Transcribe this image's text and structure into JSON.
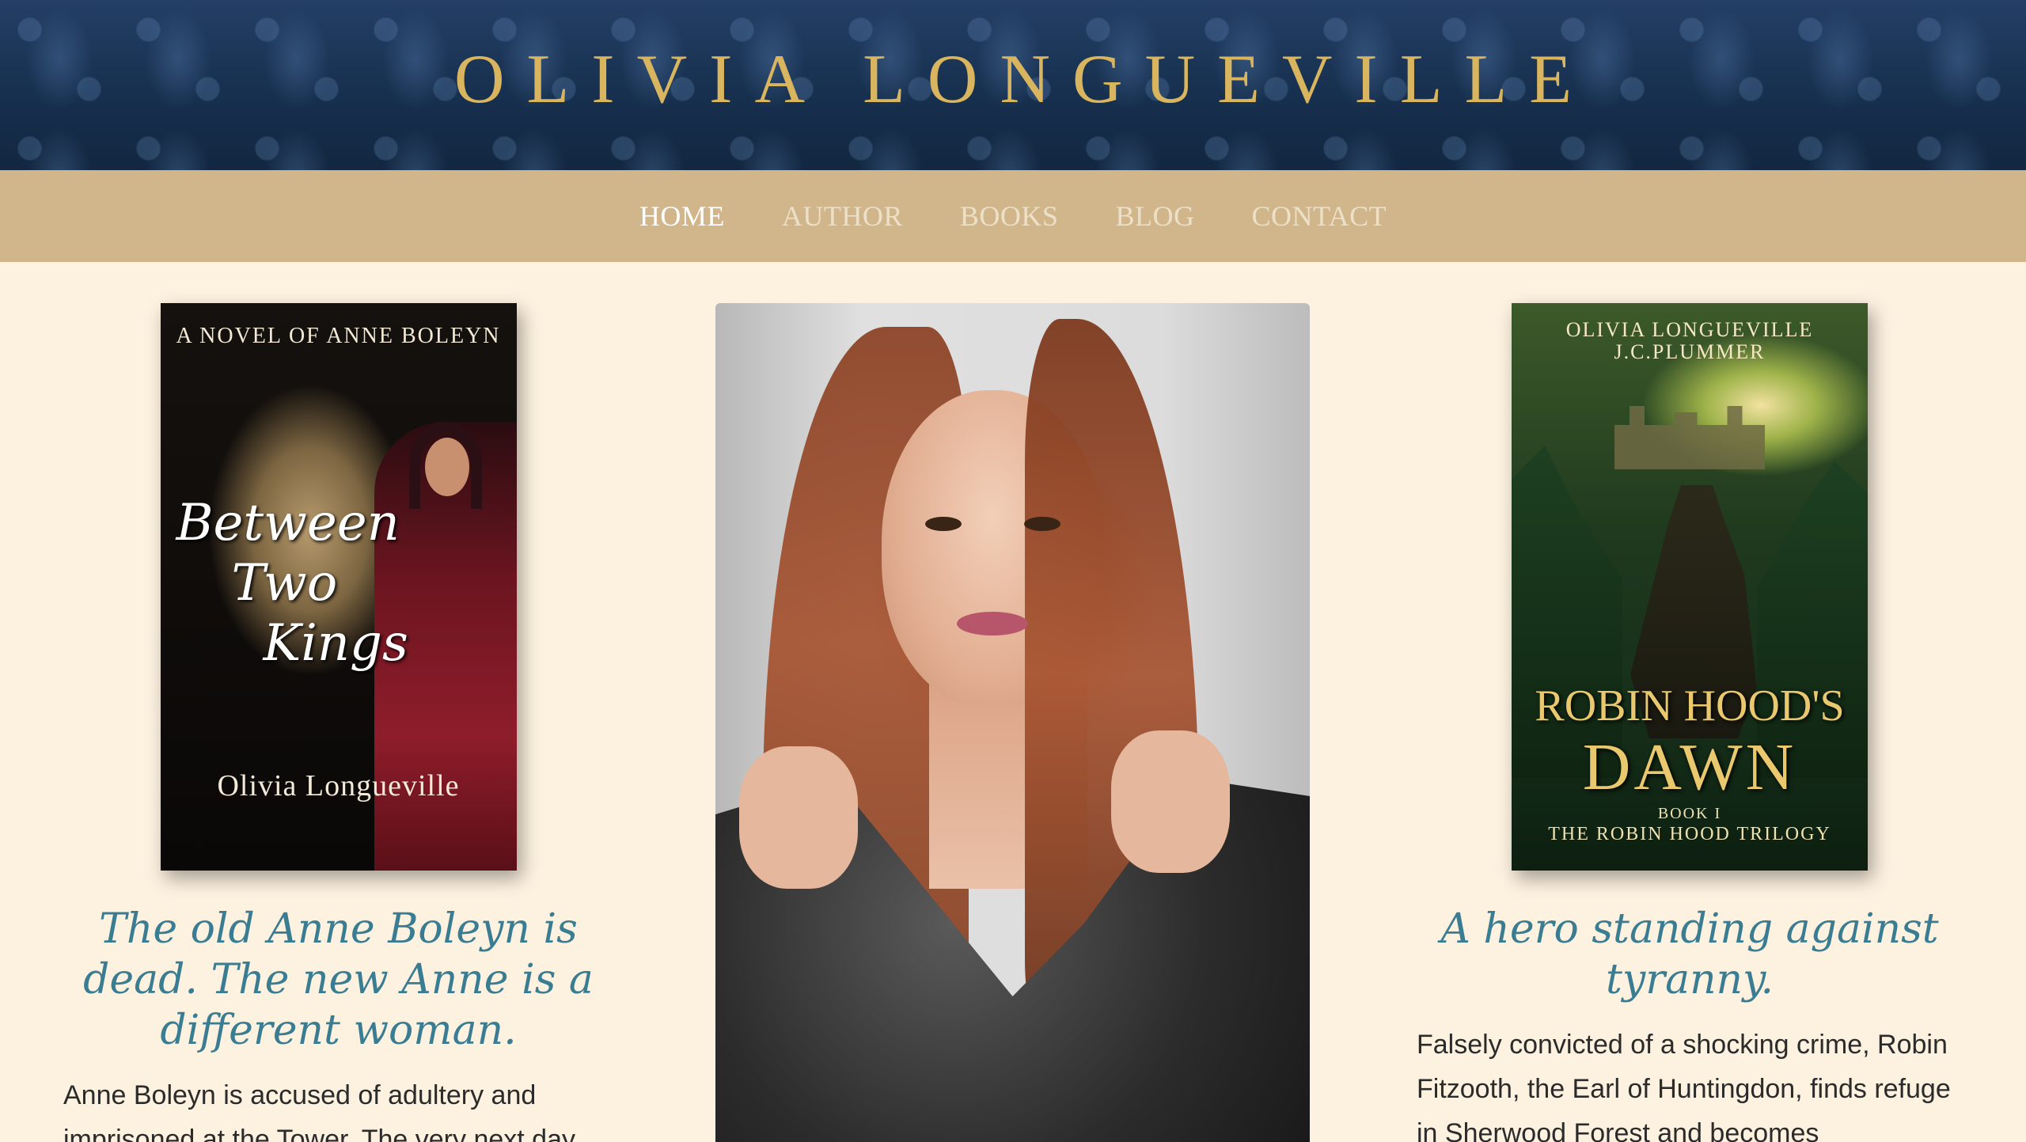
{
  "header": {
    "site_title": "OLIVIA LONGUEVILLE"
  },
  "nav": {
    "items": [
      {
        "label": "HOME",
        "active": true
      },
      {
        "label": "AUTHOR",
        "active": false
      },
      {
        "label": "BOOKS",
        "active": false
      },
      {
        "label": "BLOG",
        "active": false
      },
      {
        "label": "CONTACT",
        "active": false
      }
    ]
  },
  "left_book": {
    "cover_top": "A NOVEL OF ANNE BOLEYN",
    "cover_title_lines": [
      "Between",
      "Two",
      "Kings"
    ],
    "cover_author": "Olivia Longueville",
    "tagline": "The old Anne Boleyn is dead. The new Anne is a different woman.",
    "blurb": "Anne Boleyn is accused of adultery and imprisoned at the Tower. The very next day"
  },
  "right_book": {
    "cover_authors": [
      "OLIVIA LONGUEVILLE",
      "J.C.PLUMMER"
    ],
    "cover_title_line1": "ROBIN HOOD'S",
    "cover_title_line2": "DAWN",
    "cover_book": "BOOK I",
    "cover_series": "THE ROBIN HOOD TRILOGY",
    "tagline": "A hero standing against tyranny.",
    "blurb": "Falsely convicted of a shocking crime, Robin Fitzooth, the Earl of Huntingdon, finds refuge in Sherwood Forest and becomes"
  },
  "colors": {
    "header_bg": "#1a3154",
    "title_gold": "#d8b55e",
    "nav_bg": "#d2b68b",
    "page_bg": "#fdf1e0",
    "tagline_teal": "#3a7d92"
  }
}
